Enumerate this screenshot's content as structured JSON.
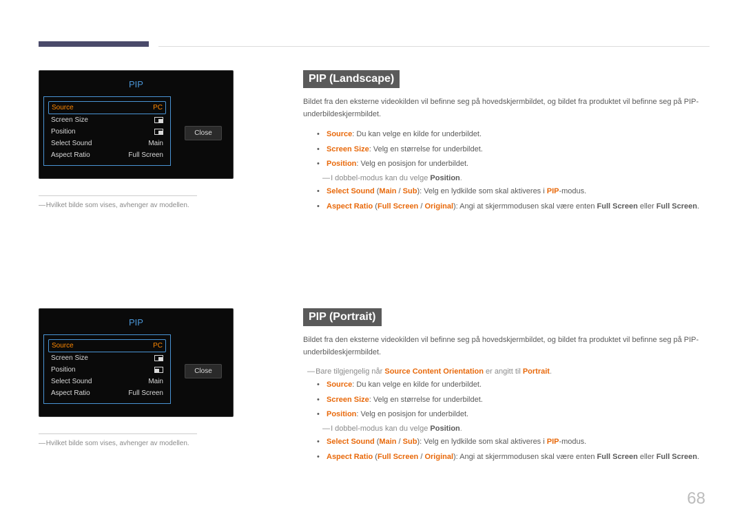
{
  "page_number": "68",
  "osd": {
    "title": "PIP",
    "close": "Close",
    "rows": {
      "source_label": "Source",
      "source_value": "PC",
      "screensize_label": "Screen Size",
      "position_label": "Position",
      "selectsound_label": "Select Sound",
      "selectsound_value": "Main",
      "aspect_label": "Aspect Ratio",
      "aspect_value": "Full Screen"
    }
  },
  "left_note": "Hvilket bilde som vises, avhenger av modellen.",
  "sec1": {
    "heading": "PIP (Landscape)",
    "intro": "Bildet fra den eksterne videokilden vil befinne seg på hovedskjermbildet, og bildet fra produktet vil befinne seg på PIP-underbildeskjermbildet.",
    "b1_bold": "Source",
    "b1_rest": ": Du kan velge en kilde for underbildet.",
    "b2_bold": "Screen Size",
    "b2_rest": ": Velg en størrelse for underbildet.",
    "b3_bold": "Position",
    "b3_rest": ": Velg en posisjon for underbildet.",
    "sub_pre": "I dobbel-modus kan du velge ",
    "sub_bold": "Position",
    "b4_a": "Select Sound",
    "b4_b": "Main",
    "b4_c": "Sub",
    "b4_rest_pre": " (",
    "b4_rest_mid": " / ",
    "b4_rest_post": "): Velg en lydkilde som skal aktiveres i ",
    "b4_pip": "PIP",
    "b4_tail": "-modus.",
    "b5_a": "Aspect Ratio",
    "b5_b": "Full Screen",
    "b5_c": "Original",
    "b5_open": "  (",
    "b5_mid": " / ",
    "b5_post": "): Angi at skjermmodusen skal være enten ",
    "b5_fs1": "Full Screen",
    "b5_or": " eller ",
    "b5_fs2": "Full Screen",
    "b5_dot": "."
  },
  "sec2": {
    "heading": "PIP (Portrait)",
    "intro": "Bildet fra den eksterne videokilden vil befinne seg på hovedskjermbildet, og bildet fra produktet vil befinne seg på PIP-underbildeskjermbildet.",
    "avail_pre": "Bare tilgjengelig når ",
    "avail_bold": "Source Content Orientation",
    "avail_mid": " er angitt til ",
    "avail_por": "Portrait",
    "avail_dot": "."
  }
}
